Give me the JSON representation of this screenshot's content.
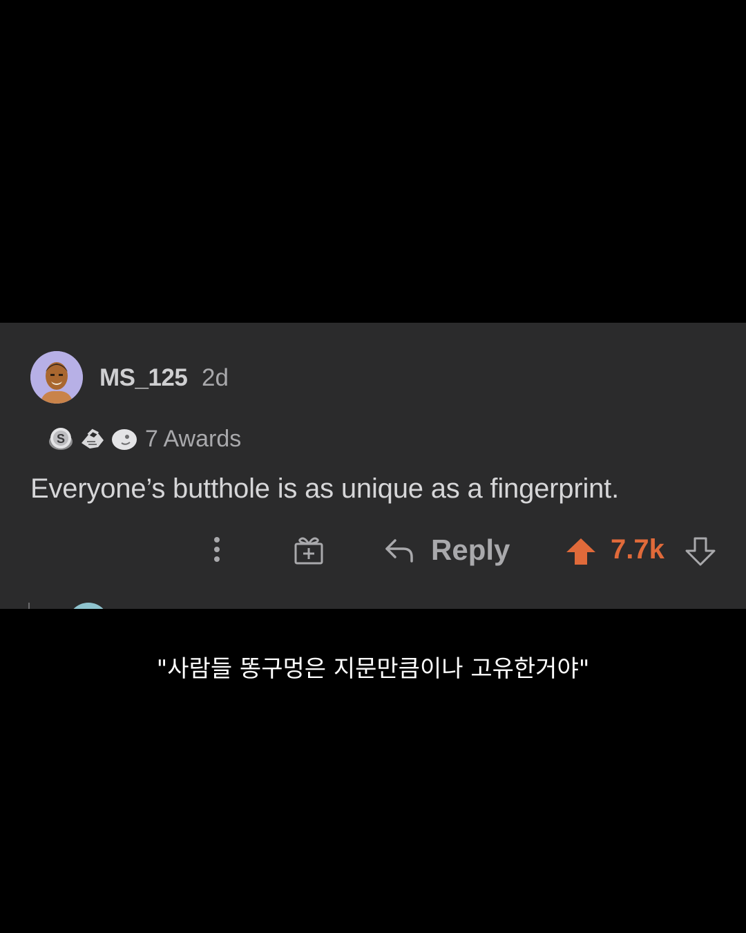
{
  "comment": {
    "username": "MS_125",
    "age": "2d",
    "awards": {
      "icons": [
        "silver-coin-award-icon",
        "handshake-award-icon",
        "ghost-award-icon"
      ],
      "label": "7 Awards"
    },
    "body": "Everyone’s butthole is as unique as a fingerprint.",
    "actions": {
      "more_icon": "more-vertical-icon",
      "gift_icon": "gift-award-icon",
      "reply_label": "Reply",
      "score": "7.7k",
      "upvote_color": "#e06a3a"
    }
  },
  "caption": "\"사람들 똥구멍은 지문만큼이나 고유한거야\"",
  "colors": {
    "background": "#000000",
    "card": "#2b2b2c",
    "accent": "#e06a3a"
  }
}
